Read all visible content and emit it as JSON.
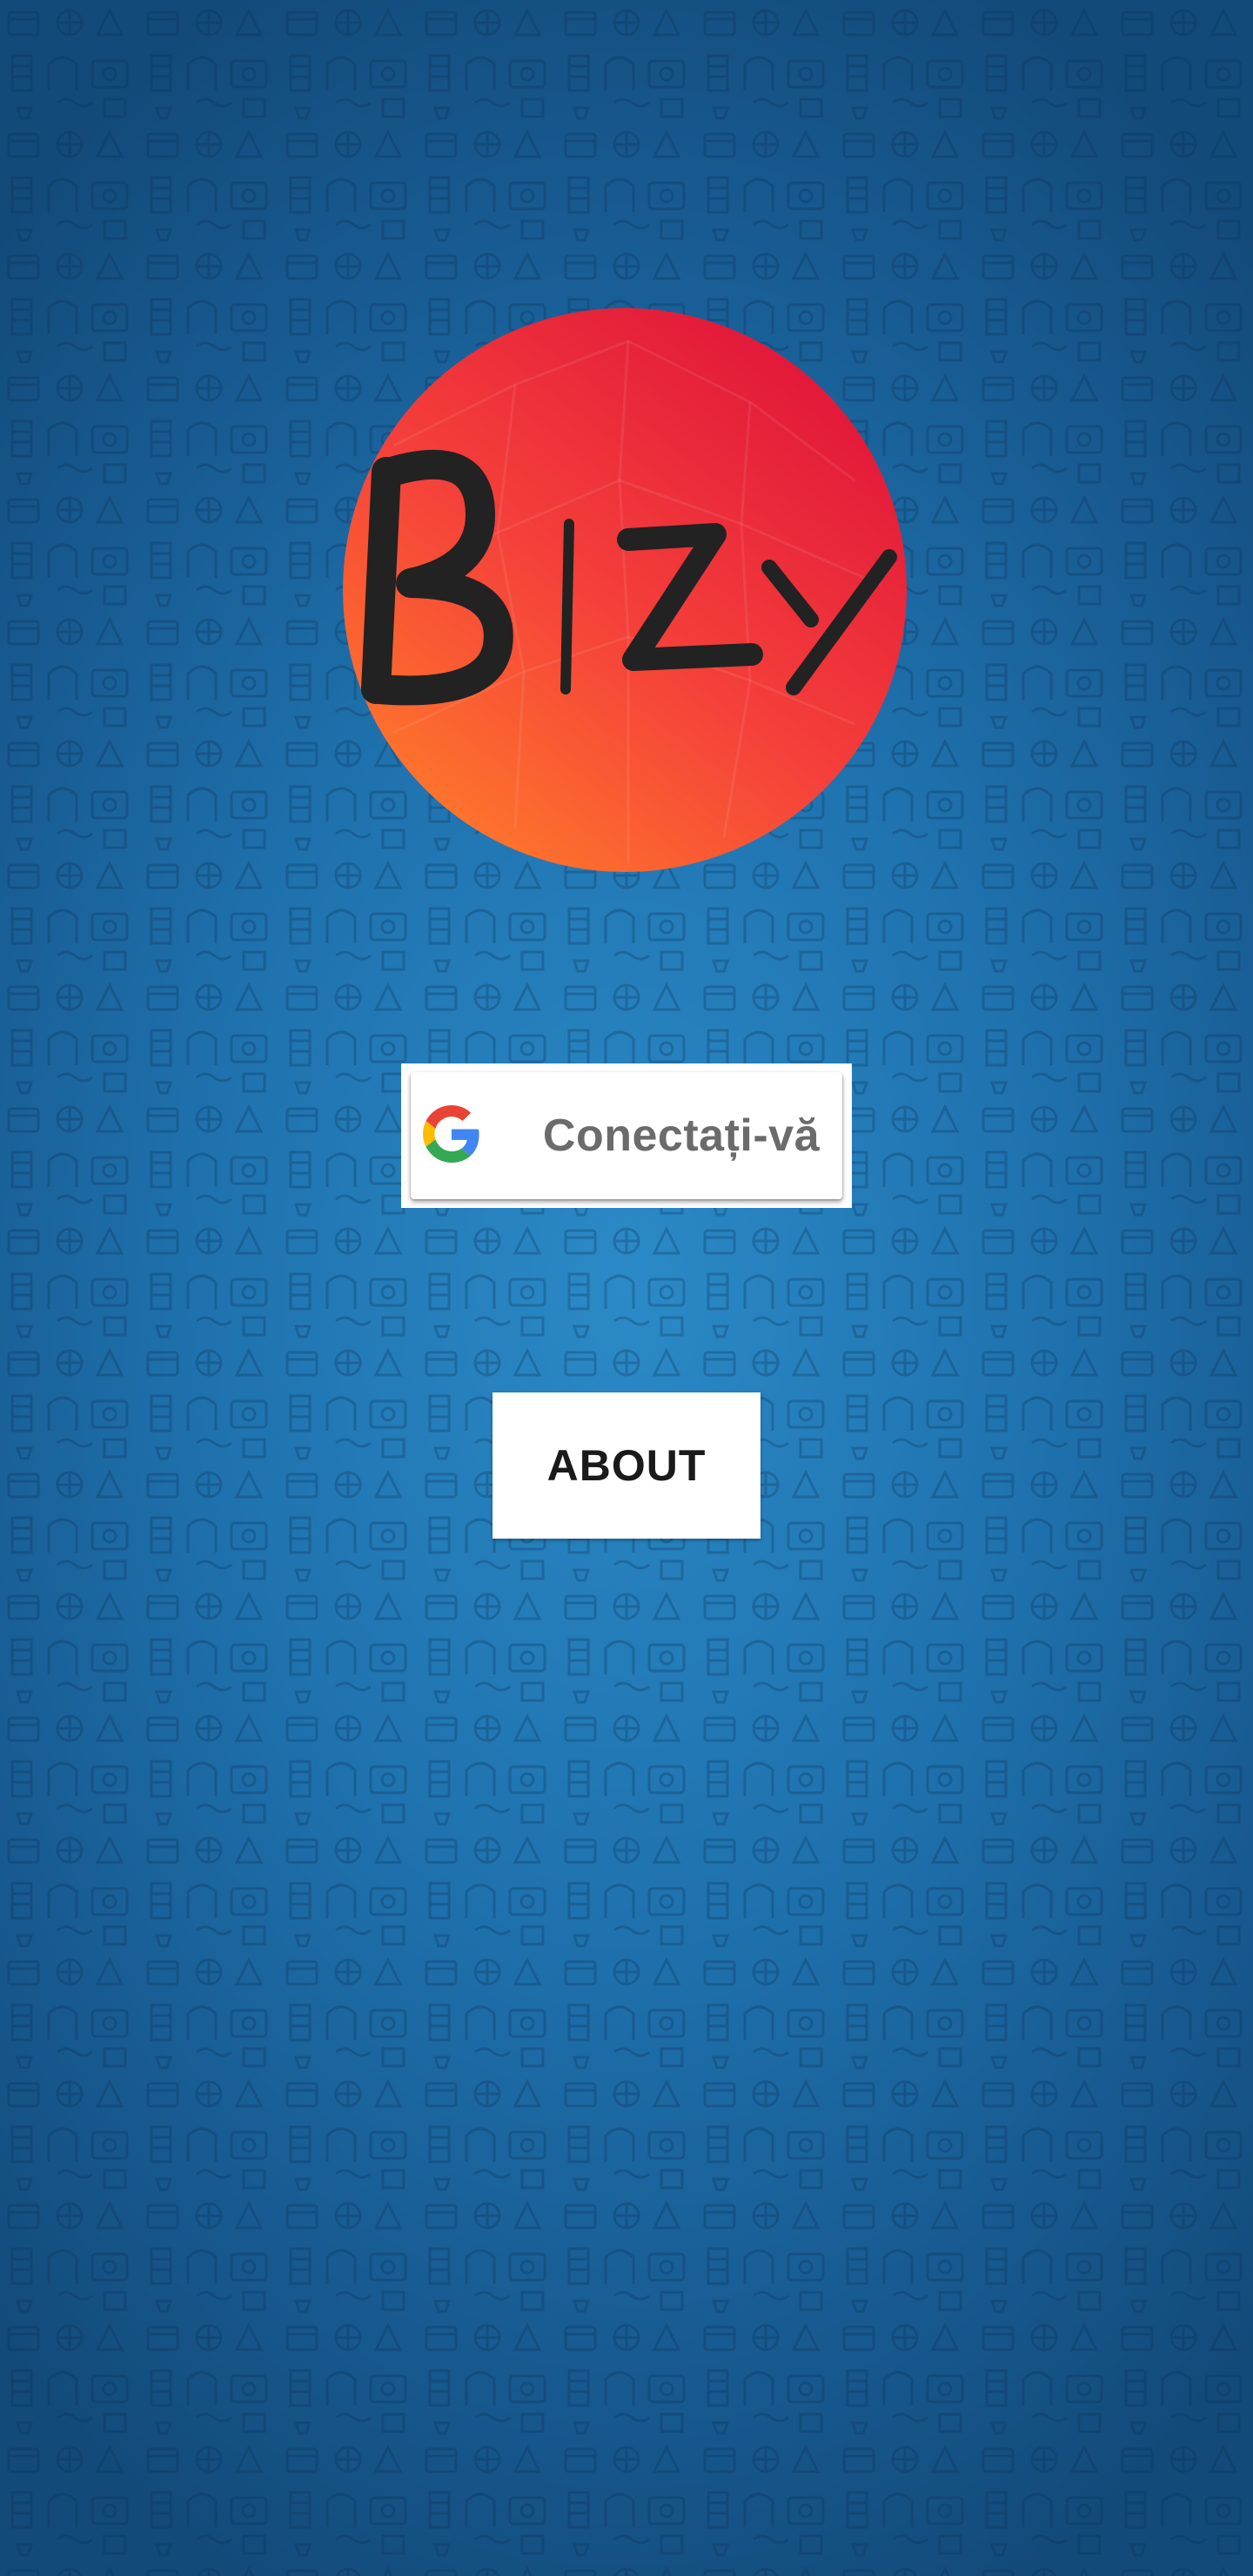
{
  "app": {
    "logo_text": "BIZY",
    "logo_icon": "bizy-logo"
  },
  "login": {
    "google_button_label": "Conectați-vă",
    "google_icon": "google-g-icon"
  },
  "about": {
    "label": "ABOUT"
  },
  "colors": {
    "background": "#1f72ae",
    "logo_red": "#e8283a",
    "logo_orange": "#ff6a2a",
    "button_bg": "#ffffff",
    "google_label": "#6b6b6b",
    "about_label": "#1a1a1a"
  }
}
